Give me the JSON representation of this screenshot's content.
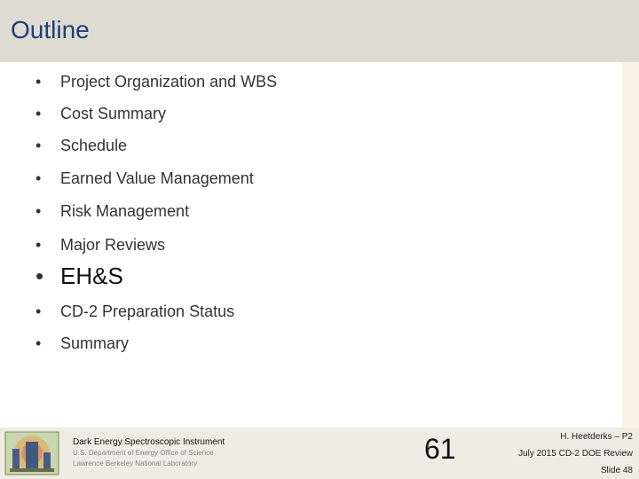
{
  "slide": {
    "title": "Outline",
    "bullets": [
      {
        "text": "Project Organization and WBS"
      },
      {
        "text": "Cost Summary"
      },
      {
        "text": "Schedule"
      },
      {
        "text": "Earned Value Management"
      },
      {
        "text": "Risk Management"
      },
      {
        "text": "Major Reviews"
      },
      {
        "text": "EH&S"
      },
      {
        "text": "CD-2 Preparation Status"
      },
      {
        "text": "Summary"
      }
    ],
    "bullet_symbol": "•"
  },
  "footer": {
    "org_name": "Dark Energy Spectroscopic Instrument",
    "org_line1": "U.S. Department of Energy Office of Science",
    "org_line2": "Lawrence Berkeley National Laboratory",
    "page_number": "61",
    "presenter": "H. Heetderks – P2",
    "event": "July 2015 CD-2 DOE Review",
    "slide_label": "Slide 48"
  },
  "colors": {
    "title": "#1f3f78",
    "title_bar": "#dedbd2",
    "footer_bg": "#efece3"
  }
}
